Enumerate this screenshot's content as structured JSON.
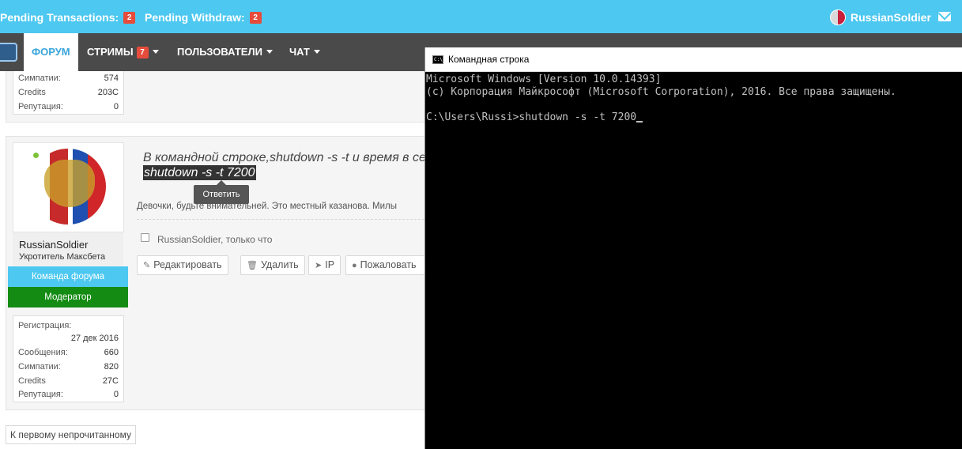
{
  "topbar": {
    "pending_transactions": {
      "label": "Pending Transactions:",
      "count": "2"
    },
    "pending_withdraw": {
      "label": "Pending Withdraw:",
      "count": "2"
    },
    "username": "RussianSoldier"
  },
  "nav": {
    "forum": "ФОРУМ",
    "streams": "СТРИМЫ",
    "streams_badge": "7",
    "users": "ПОЛЬЗОВАТЕЛИ",
    "chat": "ЧАТ"
  },
  "prev_post": {
    "stats": [
      {
        "label": "Симпатии:",
        "value": "574"
      },
      {
        "label": "Credits",
        "value": "203C"
      },
      {
        "label": "Репутация:",
        "value": "0"
      }
    ]
  },
  "post": {
    "author": "RussianSoldier",
    "author_title": "Укротитель Максбета",
    "roles": [
      "Команда форума",
      "Модератор"
    ],
    "stats": [
      {
        "label": "Регистрация:",
        "value": ""
      },
      {
        "label": "",
        "value": "27 дек 2016"
      },
      {
        "label": "Сообщения:",
        "value": "660"
      },
      {
        "label": "Симпатии:",
        "value": "820"
      },
      {
        "label": "Credits",
        "value": "27C"
      },
      {
        "label": "Репутация:",
        "value": "0"
      }
    ],
    "message_line1": "В командной строке,shutdown -s -t и время в секу",
    "message_line2": "shutdown -s -t 7200",
    "reply_tooltip": "Ответить",
    "signature": "Девочки, будьте внимательней. Это местный казанова. Милы",
    "meta": "RussianSoldier, только что",
    "actions": [
      "Редактировать",
      "Удалить",
      "IP",
      "Пожаловать"
    ]
  },
  "first_unread": "К первому непрочитанному",
  "cmd": {
    "icon_text": "C:\\",
    "title": "Командная строка",
    "lines": [
      "Microsoft Windows [Version 10.0.14393]",
      "(c) Корпорация Майкрософт (Microsoft Corporation), 2016. Все права защищены.",
      "",
      "C:\\Users\\Russi>shutdown -s -t 7200"
    ]
  },
  "colors": {
    "topbar": "#4dc8f0",
    "navbar": "#4a4a4a",
    "badge": "#e64b3c",
    "role_team": "#4dc8f0",
    "role_moderator": "#148c14"
  }
}
